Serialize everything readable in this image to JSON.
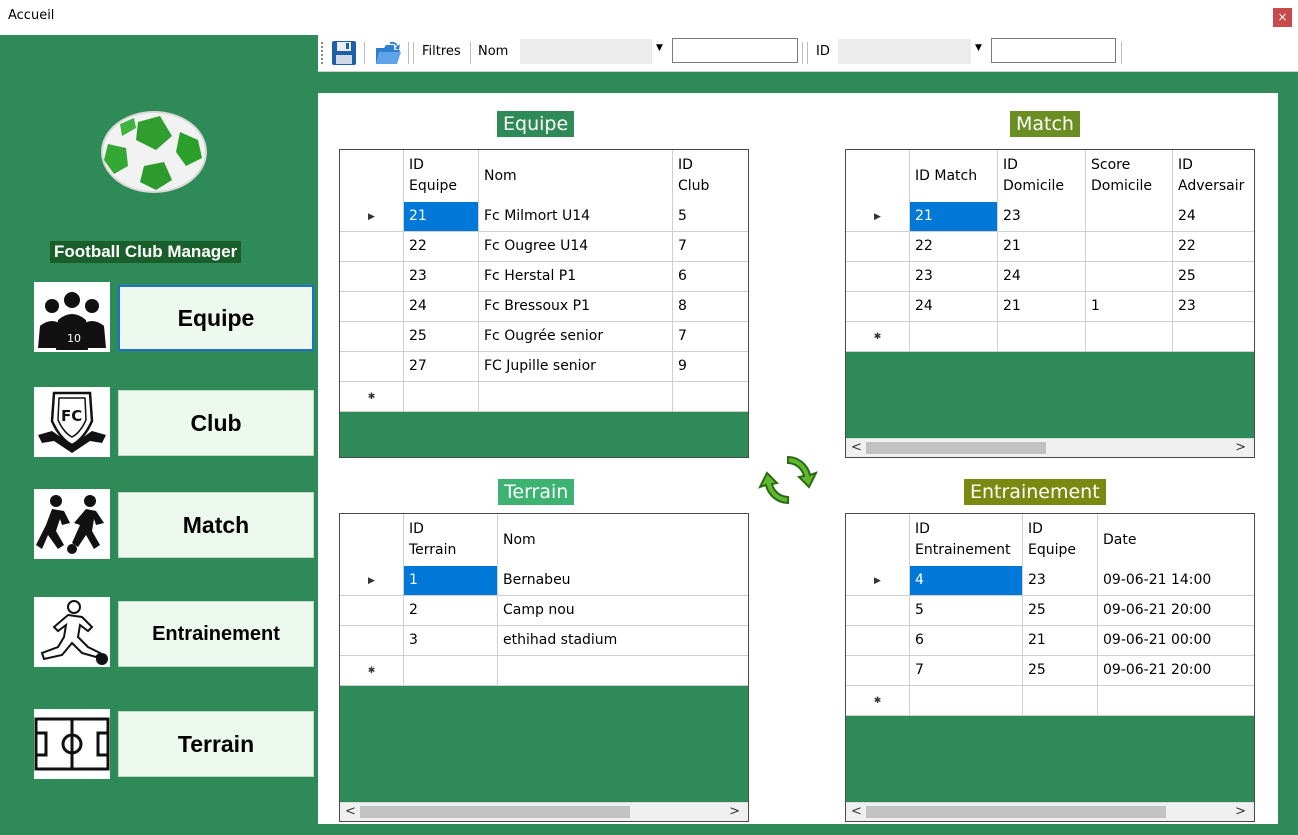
{
  "window": {
    "title": "Accueil",
    "close": "×"
  },
  "sidebar": {
    "app_name": "Football Club Manager",
    "buttons": [
      {
        "label": "Equipe",
        "icon": "team-players-icon"
      },
      {
        "label": "Club",
        "icon": "fc-shield-icon"
      },
      {
        "label": "Match",
        "icon": "players-running-icon"
      },
      {
        "label": "Entrainement",
        "icon": "kicking-player-icon"
      },
      {
        "label": "Terrain",
        "icon": "football-pitch-icon"
      }
    ]
  },
  "toolbar": {
    "filters_label": "Filtres",
    "name_label": "Nom",
    "name_combo_value": "",
    "name_input_value": "",
    "id_label": "ID",
    "id_combo_value": "",
    "id_input_value": ""
  },
  "equipe": {
    "title": "Equipe",
    "title_color": "#2e8b57",
    "columns": [
      [
        "ID",
        "Equipe"
      ],
      [
        "Nom"
      ],
      [
        "ID",
        "Club"
      ]
    ],
    "rows": [
      [
        "21",
        "Fc Milmort U14",
        "5"
      ],
      [
        "22",
        "Fc Ougree U14",
        "7"
      ],
      [
        "23",
        "Fc Herstal P1",
        "6"
      ],
      [
        "24",
        "Fc Bressoux P1",
        "8"
      ],
      [
        "25",
        "Fc Ougrée senior",
        "7"
      ],
      [
        "27",
        "FC Jupille senior",
        "9"
      ]
    ]
  },
  "match": {
    "title": "Match",
    "title_color": "#6b8e23",
    "columns": [
      [
        "ID Match"
      ],
      [
        "ID",
        "Domicile"
      ],
      [
        "Score",
        "Domicile"
      ],
      [
        "ID",
        "Adversair"
      ]
    ],
    "rows": [
      [
        "21",
        "23",
        "",
        "24"
      ],
      [
        "22",
        "21",
        "",
        "22"
      ],
      [
        "23",
        "24",
        "",
        "25"
      ],
      [
        "24",
        "21",
        "1",
        "23"
      ]
    ]
  },
  "terrain": {
    "title": "Terrain",
    "title_color": "#3cb371",
    "columns": [
      [
        "ID",
        "Terrain"
      ],
      [
        "Nom"
      ]
    ],
    "rows": [
      [
        "1",
        "Bernabeu"
      ],
      [
        "2",
        "Camp nou"
      ],
      [
        "3",
        "ethihad stadium"
      ]
    ]
  },
  "entrainement": {
    "title": "Entrainement",
    "title_color": "#7a8a10",
    "columns": [
      [
        "ID",
        "Entrainement"
      ],
      [
        "ID",
        "Equipe"
      ],
      [
        "Date"
      ]
    ],
    "rows": [
      [
        "4",
        "23",
        "09-06-21 14:00"
      ],
      [
        "5",
        "25",
        "09-06-21 20:00"
      ],
      [
        "6",
        "21",
        "09-06-21 00:00"
      ],
      [
        "7",
        "25",
        "09-06-21 20:00"
      ]
    ]
  },
  "glyphs": {
    "current_row": "▶",
    "new_row": "✱",
    "scroll_left": "<",
    "scroll_right": ">",
    "combo_arrow": "▼"
  },
  "colors": {
    "background": "#2e8b57",
    "selection": "#0078d7",
    "app_name_bg": "#1a5f2b"
  }
}
